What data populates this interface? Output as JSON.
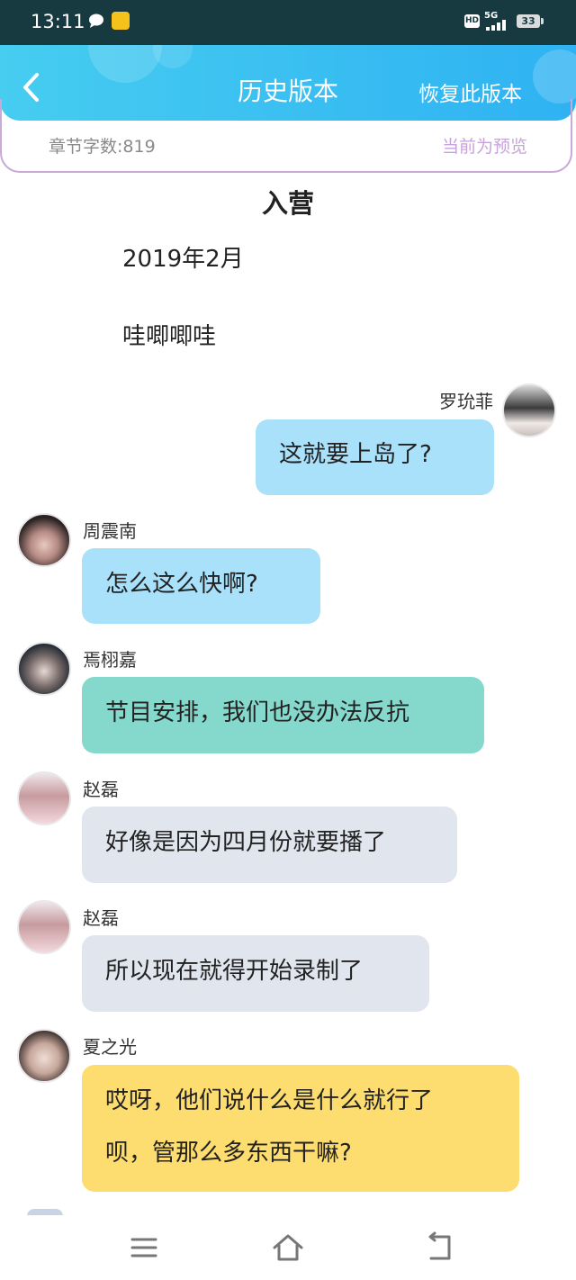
{
  "status_bar": {
    "time": "13:11",
    "hd_badge": "HD",
    "network": "5G",
    "battery": "33"
  },
  "header": {
    "title": "历史版本",
    "restore_label": "恢复此版本",
    "back_icon": "chevron-left-icon"
  },
  "info": {
    "word_count": "章节字数:819",
    "preview_status": "当前为预览"
  },
  "chapter": {
    "title": "入营",
    "date": "2019年2月",
    "line": "哇唧唧哇"
  },
  "messages": [
    {
      "name": "罗玧菲",
      "text": "这就要上岛了?",
      "color": "#a9e1fb",
      "side": "right"
    },
    {
      "name": "周震南",
      "text": "怎么这么快啊?",
      "color": "#a9e1fb",
      "side": "left"
    },
    {
      "name": "焉栩嘉",
      "text": "节目安排，我们也没办法反抗",
      "color": "#85d9cc",
      "side": "left"
    },
    {
      "name": "赵磊",
      "text": "好像是因为四月份就要播了",
      "color": "#e1e6ee",
      "side": "left"
    },
    {
      "name": "赵磊",
      "text": "所以现在就得开始录制了",
      "color": "#e1e6ee",
      "side": "left"
    },
    {
      "name": "夏之光",
      "text_line1": "哎呀，他们说什么是什么就行了",
      "text_line2": "呗，管那么多东西干嘛?",
      "color": "#fddd6f",
      "side": "left"
    }
  ],
  "navbar": {
    "menu_icon": "menu-icon",
    "home_icon": "home-icon",
    "back_icon": "back-icon"
  }
}
